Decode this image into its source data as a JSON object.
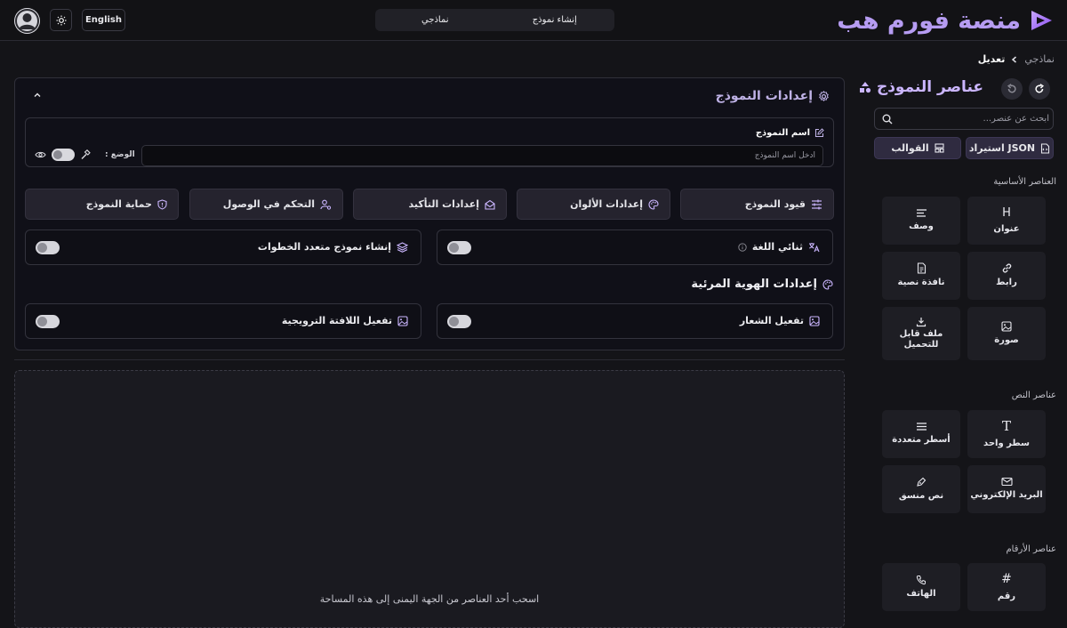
{
  "header": {
    "brand": "منصة فورم هب",
    "tabs": [
      "إنشاء نموذج",
      "نماذجي"
    ],
    "language_button": "English"
  },
  "breadcrumb": {
    "items": [
      "نماذجي",
      "تعديل"
    ]
  },
  "sidebar": {
    "title": "عناصر النموذج",
    "search_placeholder": "ابحث عن عنصر...",
    "import_button": "JSON استيراد",
    "templates_button": "القوالب",
    "sections": [
      {
        "label": "العناصر الأساسية",
        "items": [
          "عنوان",
          "وصف",
          "رابط",
          "نافذة نصية",
          "صورة",
          "ملف قابل للتحميل"
        ]
      },
      {
        "label": "عناصر النص",
        "items": [
          "سطر واحد",
          "أسطر متعددة",
          "البريد الإلكتروني",
          "نص منسق"
        ]
      },
      {
        "label": "عناصر الأرقام",
        "items": [
          "رقم",
          "الهاتف"
        ]
      }
    ]
  },
  "settings_panel": {
    "title": "إعدادات النموذج",
    "name_label": "اسم النموذج",
    "name_placeholder": "أدخل اسم النموذج",
    "mode_label": "الوضع :",
    "buttons": [
      "قيود النموذج",
      "إعدادات الألوان",
      "إعدادات التأكيد",
      "التحكم في الوصول",
      "حماية النموذج"
    ],
    "bilingual_label": "ثنائي اللغة",
    "multistep_label": "إنشاء نموذج متعدد الخطوات",
    "identity_title": "إعدادات الهوية المرئية",
    "logo_label": "تفعيل الشعار",
    "banner_label": "تفعيل اللافتة الترويجية"
  },
  "dropzone": {
    "text": "اسحب أحد العناصر من الجهة اليمنى إلى هذه المساحة"
  },
  "colors": {
    "accent": "#b69cf2",
    "background": "#141418",
    "panel": "#101018"
  }
}
